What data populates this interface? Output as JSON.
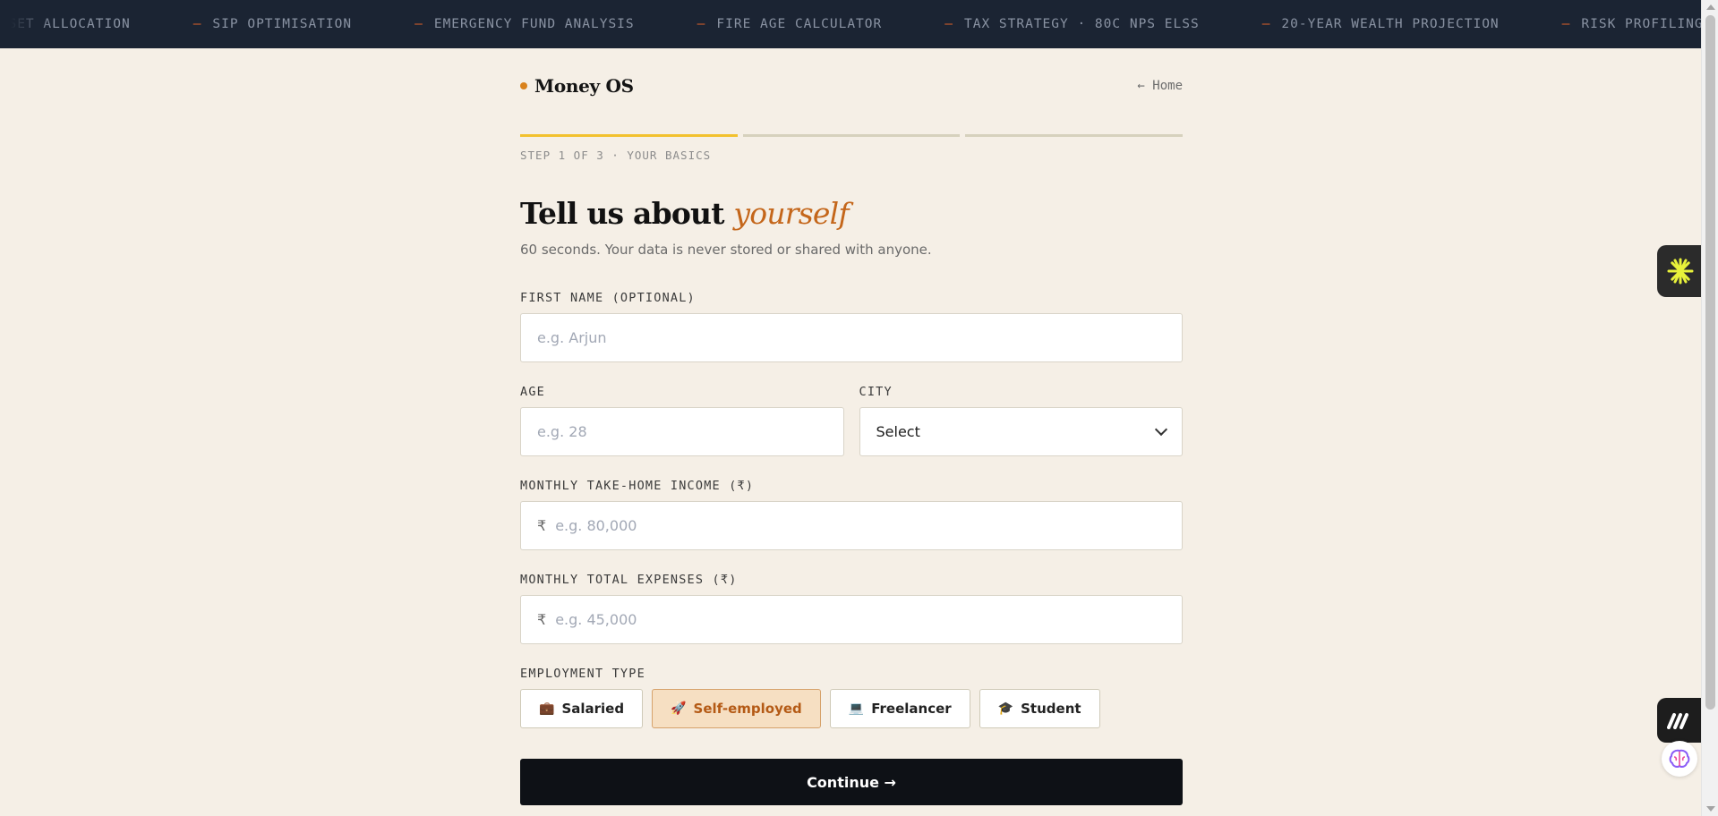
{
  "ticker": {
    "items": [
      "ASSET ALLOCATION",
      "SIP OPTIMISATION",
      "EMERGENCY FUND ANALYSIS",
      "FIRE AGE CALCULATOR",
      "TAX STRATEGY · 80C NPS ELSS",
      "20-YEAR WEALTH PROJECTION",
      "RISK PROFILING"
    ],
    "dash": "—"
  },
  "header": {
    "brand": "Money OS",
    "home_link": "← Home"
  },
  "progress": {
    "current_step": 1,
    "total_steps": 3,
    "label": "STEP 1 OF 3 · YOUR BASICS"
  },
  "form": {
    "title_main": "Tell us about",
    "title_accent": "yourself",
    "subtitle": "60 seconds. Your data is never stored or shared with anyone.",
    "first_name": {
      "label": "FIRST NAME (OPTIONAL)",
      "placeholder": "e.g. Arjun",
      "value": ""
    },
    "age": {
      "label": "AGE",
      "placeholder": "e.g. 28",
      "value": ""
    },
    "city": {
      "label": "CITY",
      "selected": "Select"
    },
    "income": {
      "label": "MONTHLY TAKE-HOME INCOME (₹)",
      "currency": "₹",
      "placeholder": "e.g. 80,000",
      "value": ""
    },
    "expenses": {
      "label": "MONTHLY TOTAL EXPENSES (₹)",
      "currency": "₹",
      "placeholder": "e.g. 45,000",
      "value": ""
    },
    "employment": {
      "label": "EMPLOYMENT TYPE",
      "options": [
        {
          "icon": "💼",
          "label": "Salaried"
        },
        {
          "icon": "🚀",
          "label": "Self-employed"
        },
        {
          "icon": "💻",
          "label": "Freelancer"
        },
        {
          "icon": "🎓",
          "label": "Student"
        }
      ],
      "selected": "Self-employed"
    },
    "continue_label": "Continue →"
  },
  "colors": {
    "accent": "#c4661a",
    "ticker_bg": "#1b2433",
    "progress_active": "#f2c12e",
    "page_bg": "#f5efe6"
  },
  "icons": [
    "claude-asterisk-icon",
    "monica-m-icon",
    "brain-icon"
  ]
}
